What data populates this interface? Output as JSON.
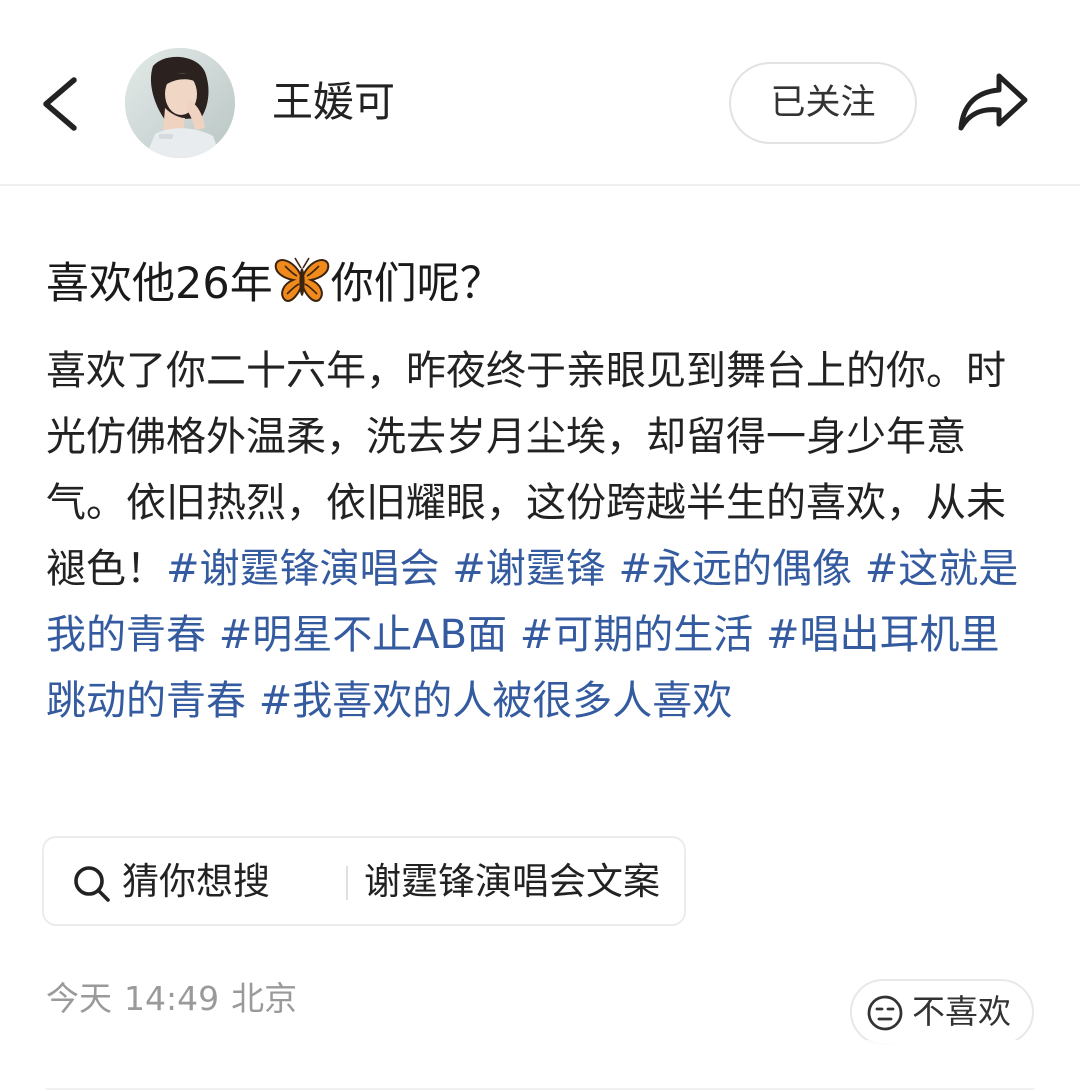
{
  "header": {
    "username": "王媛可",
    "follow_label": "已关注"
  },
  "post": {
    "title_before": "喜欢他26年",
    "title_after": "你们呢？",
    "body_text": "喜欢了你二十六年，昨夜终于亲眼见到舞台上的你。时光仿佛格外温柔，洗去岁月尘埃，却留得一身少年意气。依旧热烈，依旧耀眼，这份跨越半生的喜欢，从未褪色！",
    "hashtags": [
      "#谢霆锋演唱会",
      "#谢霆锋",
      "#永远的偶像",
      "#这就是我的青春",
      "#明星不止AB面",
      "#可期的生活",
      "#唱出耳机里跳动的青春",
      "#我喜欢的人被很多人喜欢"
    ]
  },
  "search_suggest": {
    "label": "猜你想搜",
    "query": "谢霆锋演唱会文案"
  },
  "meta": {
    "date": "今天",
    "time": "14:49",
    "location": "北京"
  },
  "actions": {
    "dislike_label": "不喜欢"
  },
  "icons": {
    "back": "chevron-left-icon",
    "share": "share-arrow-icon",
    "title_emoji": "butterfly-icon",
    "search": "search-icon",
    "dislike": "neutral-face-icon"
  },
  "colors": {
    "hashtag": "#345ba0",
    "meta_text": "#9a9a9a",
    "text": "#222222"
  }
}
